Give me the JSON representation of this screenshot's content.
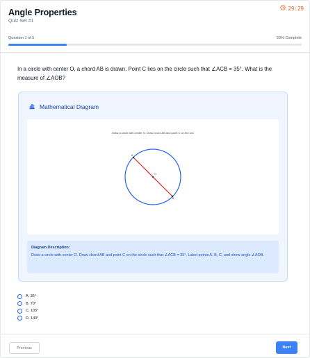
{
  "header": {
    "title": "Angle Properties",
    "subtitle": "Quiz Set #1",
    "timer": "29:29"
  },
  "progress": {
    "question_label": "Question 1 of 5",
    "complete_label": "20% Complete",
    "fraction": 0.2
  },
  "question": {
    "text": "In a circle with center O, a chord AB is drawn. Point C lies on the circle such that ∠ACB = 35°. What is the measure of ∠AOB?"
  },
  "diagram": {
    "heading": "Mathematical Diagram",
    "caption": "Draw a circle with center O. Draw chord AB and point C on the circ",
    "point_labels": {
      "A": "A",
      "B": "B",
      "O": "O"
    },
    "description_title": "Diagram Description:",
    "description_text": "Draw a circle with center O. Draw chord AB and point C on the circle such that ∠ACB = 35°. Label points A, B, C, and show angle ∠AOB.",
    "colors": {
      "circle": "#2563eb",
      "chord": "#dc2626"
    }
  },
  "options": [
    {
      "label": "A. 35°"
    },
    {
      "label": "B. 70°"
    },
    {
      "label": "C. 105°"
    },
    {
      "label": "D. 140°"
    }
  ],
  "footer": {
    "previous_label": "Previous",
    "next_label": "Next"
  },
  "colors": {
    "accent": "#3b82f6",
    "timer": "#ea580c"
  },
  "icons": {
    "timer": "clock-icon",
    "diagram": "bar-chart-icon"
  }
}
